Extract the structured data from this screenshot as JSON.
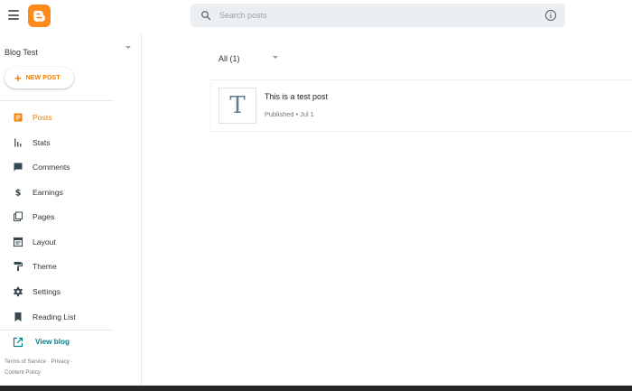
{
  "header": {
    "search_placeholder": "Search posts"
  },
  "sidebar": {
    "blog_name": "Blog Test",
    "new_post_label": "NEW POST",
    "items": [
      {
        "label": "Posts",
        "icon": "posts-icon",
        "active": true
      },
      {
        "label": "Stats",
        "icon": "stats-icon"
      },
      {
        "label": "Comments",
        "icon": "comments-icon"
      },
      {
        "label": "Earnings",
        "icon": "dollar-icon"
      },
      {
        "label": "Pages",
        "icon": "pages-icon"
      },
      {
        "label": "Layout",
        "icon": "layout-icon"
      },
      {
        "label": "Theme",
        "icon": "paint-roller-icon"
      },
      {
        "label": "Settings",
        "icon": "gear-icon"
      },
      {
        "label": "Reading List",
        "icon": "bookmark-icon"
      }
    ],
    "view_blog_label": "View blog",
    "footer": {
      "terms": "Terms of Service",
      "sep1": "·",
      "privacy": "Privacy",
      "sep2": "·",
      "content_policy": "Content Policy"
    }
  },
  "main": {
    "filter_label": "All (1)",
    "posts": [
      {
        "thumb_letter": "T",
        "title": "This is a test post",
        "meta": "Published • Jul 1"
      }
    ]
  },
  "colors": {
    "accent": "#f57c00",
    "brand": "#ff8a1c",
    "link": "#00838f"
  }
}
